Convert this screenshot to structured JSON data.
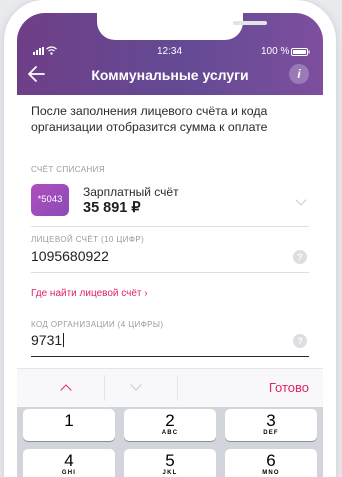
{
  "status_bar": {
    "time": "12:34",
    "battery": "100 %"
  },
  "header": {
    "back_icon": "arrow-left-icon",
    "title": "Коммунальные услуги",
    "info_label": "i"
  },
  "notice": "После заполнения лицевого счёта и кода организации отобразится сумма к оплате",
  "account": {
    "label": "СЧЁТ СПИСАНИЯ",
    "card_mask": "*5043",
    "name": "Зарплатный счёт",
    "balance": "35 891 ₽"
  },
  "personal_account": {
    "label": "ЛИЦЕВОЙ СЧЁТ (10 ЦИФР)",
    "value": "1095680922",
    "help": "?"
  },
  "find_link": "Где найти лицевой счёт ›",
  "org_code": {
    "label": "КОД ОРГАНИЗАЦИИ (4 ЦИФРЫ)",
    "value": "9731",
    "help": "?"
  },
  "toolbar": {
    "done_label": "Готово"
  },
  "keypad": [
    {
      "num": "1",
      "letters": ""
    },
    {
      "num": "2",
      "letters": "ABC"
    },
    {
      "num": "3",
      "letters": "DEF"
    },
    {
      "num": "4",
      "letters": "GHI"
    },
    {
      "num": "5",
      "letters": "JKL"
    },
    {
      "num": "6",
      "letters": "MNO"
    }
  ],
  "colors": {
    "accent": "#e0226e",
    "header": "#6b4690"
  }
}
